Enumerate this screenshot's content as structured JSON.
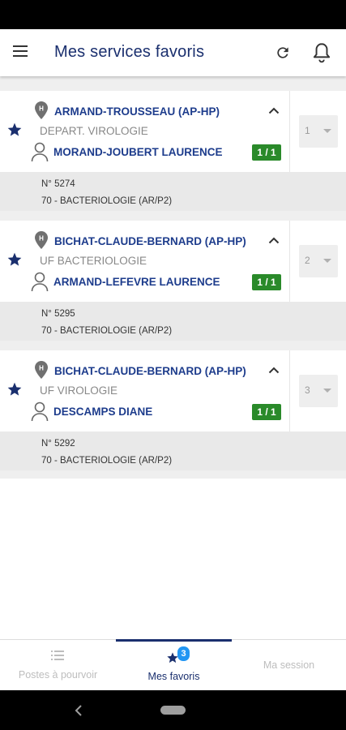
{
  "app_bar": {
    "title": "Mes services favoris"
  },
  "favorites": [
    {
      "rank": "1",
      "hospital": "ARMAND-TROUSSEAU (AP-HP)",
      "department": "DEPART. VIROLOGIE",
      "person": "MORAND-JOUBERT LAURENCE",
      "badge": "1 / 1",
      "number": "N° 5274",
      "specialty": "70 - BACTERIOLOGIE (AR/P2)"
    },
    {
      "rank": "2",
      "hospital": "BICHAT-CLAUDE-BERNARD (AP-HP)",
      "department": "UF BACTERIOLOGIE",
      "person": "ARMAND-LEFEVRE LAURENCE",
      "badge": "1 / 1",
      "number": "N° 5295",
      "specialty": "70 - BACTERIOLOGIE (AR/P2)"
    },
    {
      "rank": "3",
      "hospital": "BICHAT-CLAUDE-BERNARD (AP-HP)",
      "department": "UF VIROLOGIE",
      "person": "DESCAMPS DIANE",
      "badge": "1 / 1",
      "number": "N° 5292",
      "specialty": "70 - BACTERIOLOGIE (AR/P2)"
    }
  ],
  "bottom_nav": {
    "postes_label": "Postes à pourvoir",
    "favoris_label": "Mes favoris",
    "favoris_count": "3",
    "session_label": "Ma session"
  },
  "colors": {
    "primary": "#1a2f6e",
    "link": "#1d3c8c",
    "badge_green": "#2a8a2a",
    "count_blue": "#2196f3"
  },
  "icons": {
    "menu": "menu-icon",
    "refresh": "refresh-icon",
    "notifications": "bell-icon",
    "favorite": "star-icon",
    "hospital": "hospital-pin-icon",
    "person": "person-icon",
    "collapse": "chevron-up-icon"
  }
}
